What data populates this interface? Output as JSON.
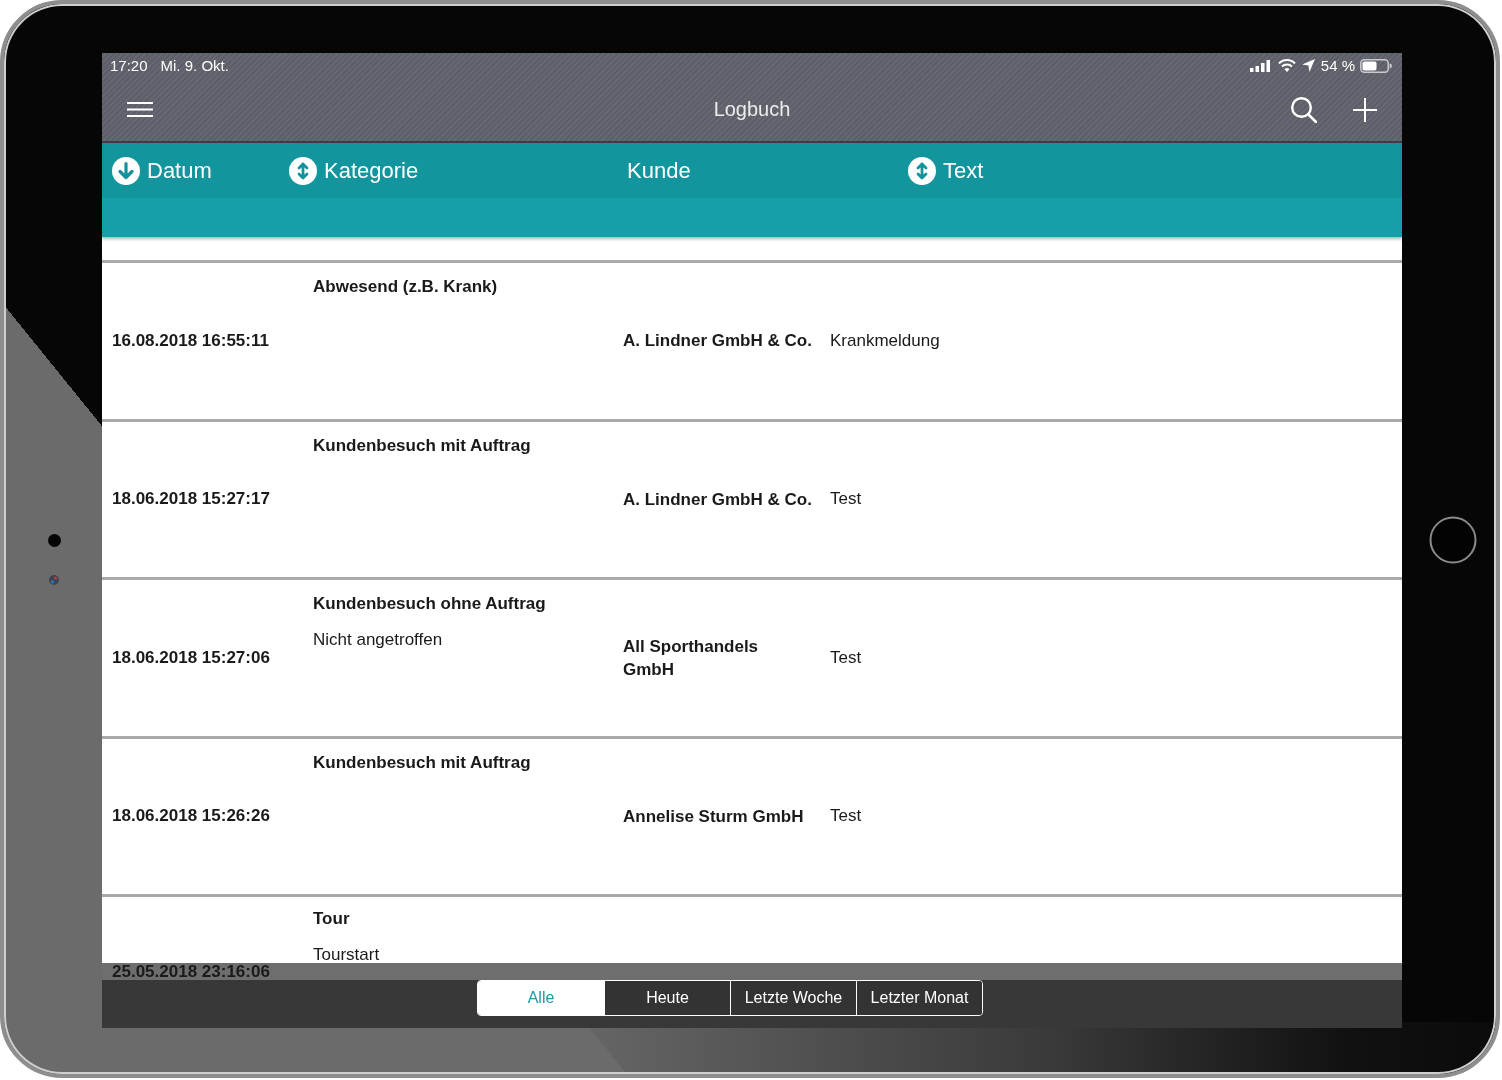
{
  "status_bar": {
    "time": "17:20",
    "date": "Mi. 9. Okt.",
    "battery": "54 %"
  },
  "nav_bar": {
    "title": "Logbuch"
  },
  "table": {
    "columns": [
      {
        "label": "Datum",
        "kind": "descending"
      },
      {
        "label": "Kategorie",
        "kind": "sortable"
      },
      {
        "label": "Kunde",
        "kind": "plain"
      },
      {
        "label": "Text",
        "kind": "sortable"
      }
    ],
    "rows": [
      {
        "date": "16.08.2018 16:55:11",
        "category": "Abwesend (z.B. Krank)",
        "customer": "A. Lindner GmbH & Co.",
        "text": "Krankmeldung"
      },
      {
        "date": "18.06.2018 15:27:17",
        "category": "Kundenbesuch mit Auftrag",
        "customer": "A. Lindner GmbH & Co.",
        "text": "Test"
      },
      {
        "date": "18.06.2018 15:27:06",
        "category": "Kundenbesuch ohne Auftrag",
        "detail": "Nicht angetroffen",
        "customer": "All Sporthandels GmbH",
        "text": "Test"
      },
      {
        "date": "18.06.2018 15:26:26",
        "category": "Kundenbesuch mit Auftrag",
        "customer": "Annelise Sturm GmbH",
        "text": "Test"
      },
      {
        "date": "25.05.2018 23:16:06",
        "category": "Tour",
        "detail": "Tourstart"
      }
    ]
  },
  "filter": {
    "segments": [
      {
        "label": "Alle",
        "selected": true
      },
      {
        "label": "Heute",
        "selected": false
      },
      {
        "label": "Letzte Woche",
        "selected": false
      },
      {
        "label": "Letzter Monat",
        "selected": false
      }
    ]
  }
}
